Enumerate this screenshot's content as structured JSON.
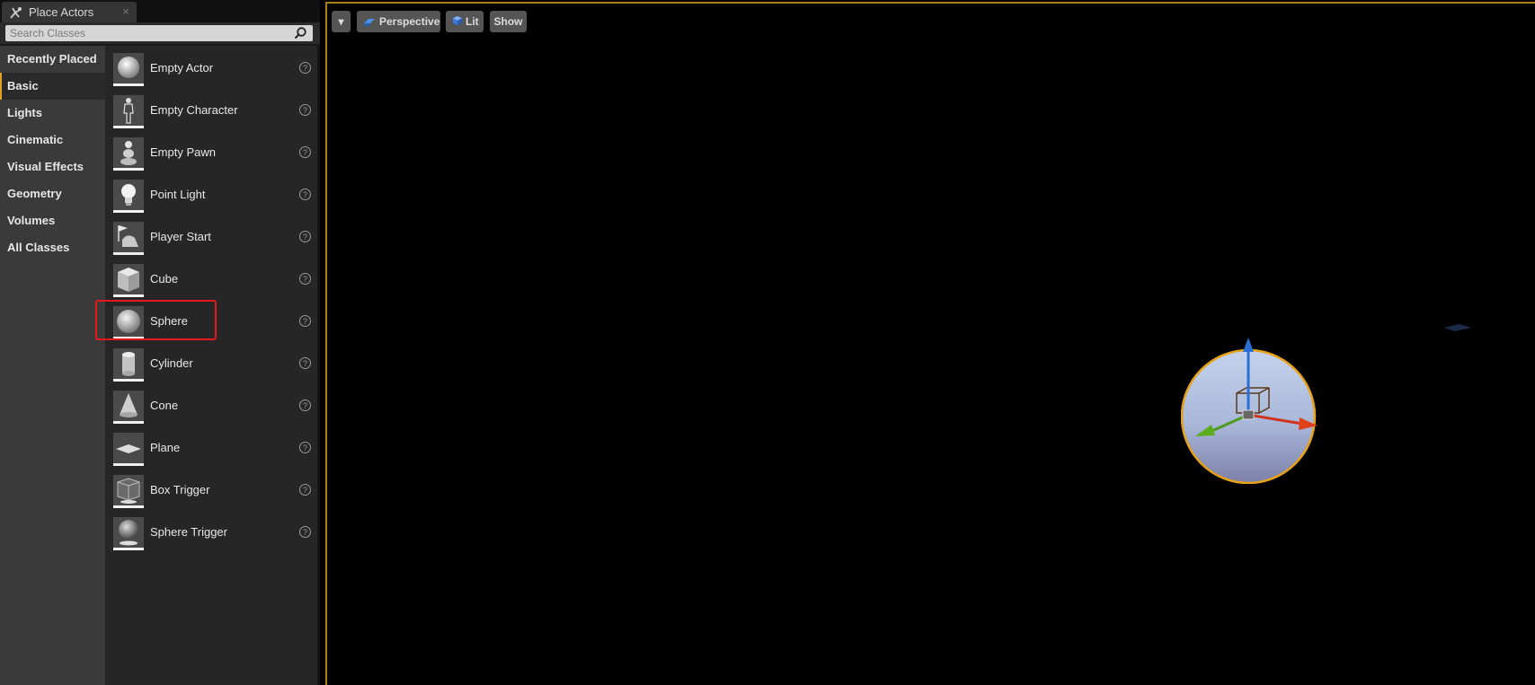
{
  "tab": {
    "title": "Place Actors",
    "close": "×"
  },
  "search": {
    "placeholder": "Search Classes"
  },
  "categories": [
    {
      "label": "Recently Placed"
    },
    {
      "label": "Basic"
    },
    {
      "label": "Lights"
    },
    {
      "label": "Cinematic"
    },
    {
      "label": "Visual Effects"
    },
    {
      "label": "Geometry"
    },
    {
      "label": "Volumes"
    },
    {
      "label": "All Classes"
    }
  ],
  "active_category": "Basic",
  "items": [
    {
      "label": "Empty Actor",
      "icon": "empty-actor-icon"
    },
    {
      "label": "Empty Character",
      "icon": "character-icon"
    },
    {
      "label": "Empty Pawn",
      "icon": "pawn-icon"
    },
    {
      "label": "Point Light",
      "icon": "light-bulb-icon"
    },
    {
      "label": "Player Start",
      "icon": "player-start-icon"
    },
    {
      "label": "Cube",
      "icon": "cube-icon"
    },
    {
      "label": "Sphere",
      "icon": "sphere-icon"
    },
    {
      "label": "Cylinder",
      "icon": "cylinder-icon"
    },
    {
      "label": "Cone",
      "icon": "cone-icon"
    },
    {
      "label": "Plane",
      "icon": "plane-icon"
    },
    {
      "label": "Box Trigger",
      "icon": "box-trigger-icon"
    },
    {
      "label": "Sphere Trigger",
      "icon": "sphere-trigger-icon"
    }
  ],
  "help_glyph": "?",
  "viewport": {
    "menu_glyph": "▾",
    "perspective": "Perspective",
    "lit": "Lit",
    "show": "Show"
  },
  "colors": {
    "accent": "#e3a020",
    "highlight_box": "#e5181b",
    "gizmo_x": "#d0321c",
    "gizmo_y": "#4e9a1c",
    "gizmo_z": "#2a6fd6"
  }
}
